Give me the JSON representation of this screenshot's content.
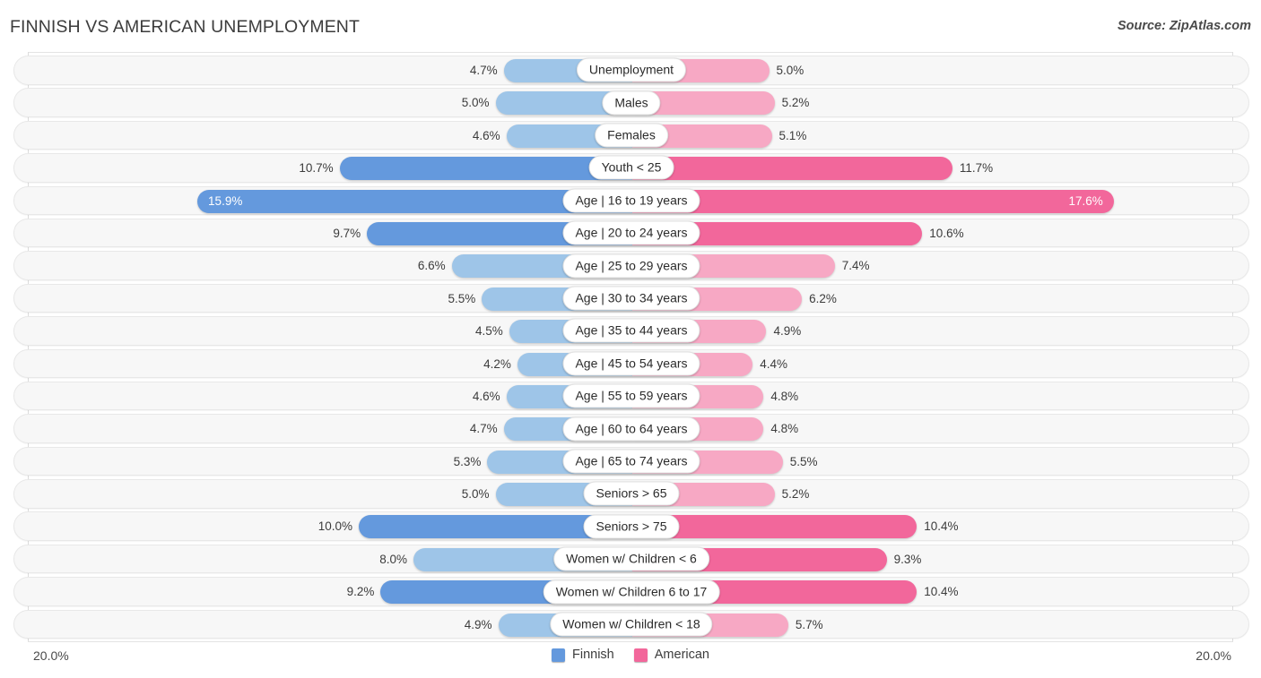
{
  "header": {
    "title": "FINNISH VS AMERICAN UNEMPLOYMENT",
    "source": "Source: ZipAtlas.com"
  },
  "legend": {
    "items": [
      {
        "label": "Finnish",
        "color": "#6499dd"
      },
      {
        "label": "American",
        "color": "#f2679b"
      }
    ]
  },
  "axis": {
    "left_max_label": "20.0%",
    "right_max_label": "20.0%",
    "max_value": 20.0
  },
  "colors": {
    "finnish_light": "#9ec5e8",
    "finnish_dark": "#6499dd",
    "american_light": "#f7a8c4",
    "american_dark": "#f2679b",
    "row_background": "#f7f7f7",
    "row_border": "#e8e8e8",
    "text": "#3c3c3c"
  },
  "chart_data": {
    "type": "bar",
    "orientation": "horizontal-diverging",
    "title": "FINNISH VS AMERICAN UNEMPLOYMENT",
    "xlabel": "",
    "ylabel": "",
    "xlim": [
      -20.0,
      20.0
    ],
    "grid": false,
    "legend_position": "bottom-center",
    "value_suffix": "%",
    "categories": [
      "Unemployment",
      "Males",
      "Females",
      "Youth < 25",
      "Age | 16 to 19 years",
      "Age | 20 to 24 years",
      "Age | 25 to 29 years",
      "Age | 30 to 34 years",
      "Age | 35 to 44 years",
      "Age | 45 to 54 years",
      "Age | 55 to 59 years",
      "Age | 60 to 64 years",
      "Age | 65 to 74 years",
      "Seniors > 65",
      "Seniors > 75",
      "Women w/ Children < 6",
      "Women w/ Children 6 to 17",
      "Women w/ Children < 18"
    ],
    "series": [
      {
        "name": "Finnish",
        "side": "left",
        "values": [
          4.7,
          5.0,
          4.6,
          10.7,
          15.9,
          9.7,
          6.6,
          5.5,
          4.5,
          4.2,
          4.6,
          4.7,
          5.3,
          5.0,
          10.0,
          8.0,
          9.2,
          4.9
        ],
        "labels": [
          "4.7%",
          "5.0%",
          "4.6%",
          "10.7%",
          "15.9%",
          "9.7%",
          "6.6%",
          "5.5%",
          "4.5%",
          "4.2%",
          "4.6%",
          "4.7%",
          "5.3%",
          "5.0%",
          "10.0%",
          "8.0%",
          "9.2%",
          "4.9%"
        ]
      },
      {
        "name": "American",
        "side": "right",
        "values": [
          5.0,
          5.2,
          5.1,
          11.7,
          17.6,
          10.6,
          7.4,
          6.2,
          4.9,
          4.4,
          4.8,
          4.8,
          5.5,
          5.2,
          10.4,
          9.3,
          10.4,
          5.7
        ],
        "labels": [
          "5.0%",
          "5.2%",
          "5.1%",
          "11.7%",
          "17.6%",
          "10.6%",
          "7.4%",
          "6.2%",
          "4.9%",
          "4.4%",
          "4.8%",
          "4.8%",
          "5.5%",
          "5.2%",
          "10.4%",
          "9.3%",
          "10.4%",
          "5.7%"
        ]
      }
    ],
    "highlighted_row_index": 4
  }
}
